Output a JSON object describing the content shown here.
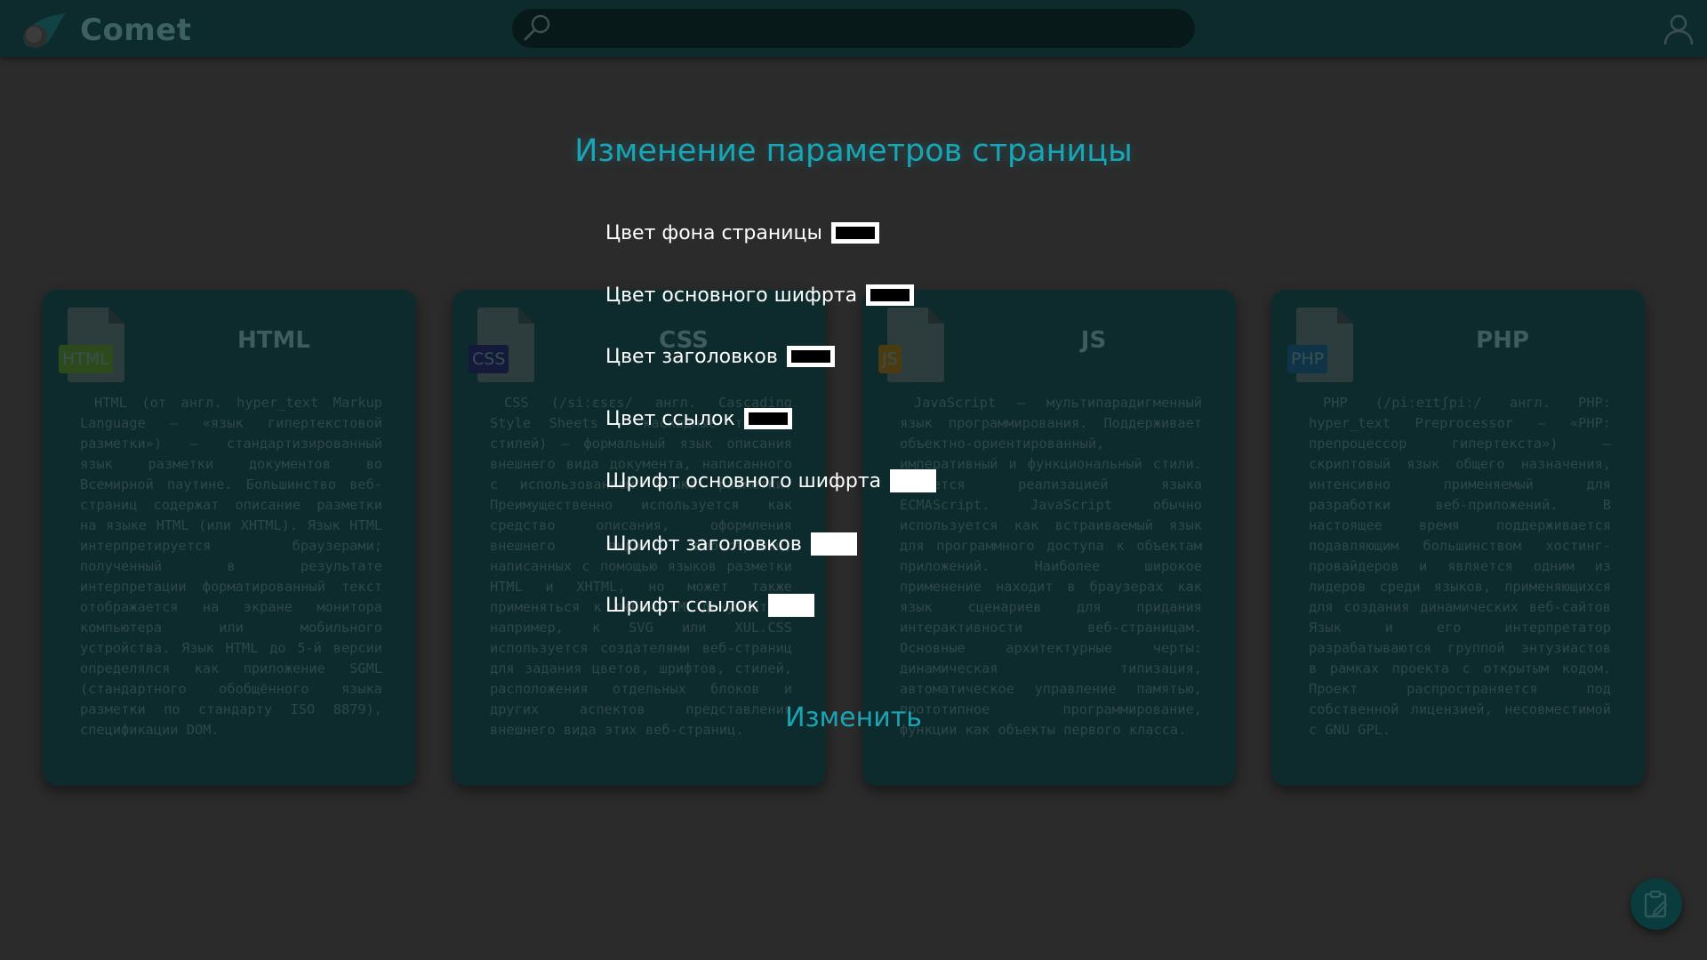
{
  "header": {
    "brand": "Comet",
    "search_placeholder": ""
  },
  "cards": [
    {
      "tag": "HTML",
      "title": "HTML",
      "tag_color": "#2c4a1c",
      "text": "HTML (от англ. hyper_text Markup Language — «язык гипертекстовой разметки») — стандартизированный язык разметки документов во Всемирной паутине. Большинство веб-страниц содержат описание разметки на языке HTML (или XHTML). Язык HTML интерпретируется браузерами; полученный в результате интерпретации форматированный текст отображается на экране монитора компьютера или мобильного устройства. Язык HTML до 5-й версии определялся как приложение SGML (стандартного обобщённого языка разметки по стандарту ISO 8879), спецификации DOM."
    },
    {
      "tag": "CSS",
      "title": "CSS",
      "tag_color": "#151a3a",
      "text": "CSS (/siːɛsɛs/ англ. Cascading Style Sheets — каскадные таблицы стилей) — формальный язык описания внешнего вида документа, написанного с использованием языка разметки. Преимущественно используется как средство описания, оформления внешнего вида веб-страниц, написанных с помощью языков разметки HTML и XHTML, но может также применяться к любым XML-документам, например, к SVG или XUL.CSS используется создателями веб-страниц для задания цветов, шрифтов, стилей, расположения отдельных блоков и других аспектов представления внешнего вида этих веб-страниц."
    },
    {
      "tag": "JS",
      "title": "JS",
      "tag_color": "#4a3c10",
      "text": "JavaScript — мультипарадигменный язык программирования. Поддерживает объектно-ориентированный, императивный и функциональный стили. Является реализацией языка ECMAScript. JavaScript обычно используется как встраиваемый язык для программного доступа к объектам приложений. Наиболее широкое применение находит в браузерах как язык сценариев для придания интерактивности веб-страницам. Основные архитектурные черты: динамическая типизация, автоматическое управление памятью, прототипное программирование, функции как объекты первого класса."
    },
    {
      "tag": "PHP",
      "title": "PHP",
      "tag_color": "#0f3447",
      "text": "PHP (/piːeɪtʃpiː/ англ. PHP: hyper_text Preprocessor — «PHP: препроцессор гипертекста») — скриптовый язык общего назначения, интенсивно применяемый для разработки веб-приложений. В настоящее время поддерживается подавляющим большинством хостинг-провайдеров и является одним из лидеров среди языков, применяющихся для создания динамических веб-сайтов Язык и его интерпретатор разрабатываются группой энтузиастов в рамках проекта с открытым кодом. Проект распространяется под собственной лицензией, несовместимой с GNU GPL."
    }
  ],
  "settings": {
    "title": "Изменение параметров страницы",
    "page_background_label": "Цвет фона страницы",
    "main_font_color_label": "Цвет основного шифрта",
    "headings_color_label": "Цвет заголовков",
    "links_color_label": "Цвет ссылок",
    "main_font_label": "Шрифт основного шифрта",
    "headings_font_label": "Шрифт заголовков",
    "links_font_label": "Шрифт ссылок",
    "page_background_value": "#000000",
    "main_font_color_value": "#000000",
    "headings_color_value": "#000000",
    "links_color_value": "#000000",
    "apply_label": "Изменить"
  },
  "colors": {
    "accent": "#19a5b5",
    "header_bg": "#0d2a2c",
    "card_bg": "#0d2a2c",
    "page_bg": "#2b2b2b"
  }
}
